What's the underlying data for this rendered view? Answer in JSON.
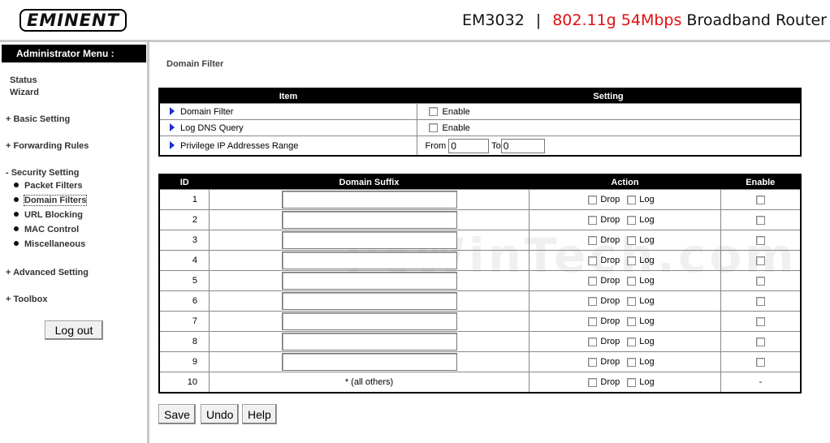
{
  "header": {
    "logo": "EMINENT",
    "model": "EM3032",
    "separator": "|",
    "spec": "802.11g 54Mbps",
    "product": "Broadband Router"
  },
  "sidebar": {
    "admin_menu": "Administrator Menu :",
    "items": [
      {
        "label": "Status"
      },
      {
        "label": "Wizard"
      },
      {
        "label": "+ Basic Setting"
      },
      {
        "label": "+ Forwarding Rules"
      },
      {
        "label": "- Security Setting"
      },
      {
        "label": "+ Advanced Setting"
      },
      {
        "label": "+ Toolbox"
      }
    ],
    "security_sub": [
      {
        "label": "Packet Filters"
      },
      {
        "label": "Domain Filters",
        "active": true
      },
      {
        "label": "URL Blocking"
      },
      {
        "label": "MAC Control"
      },
      {
        "label": "Miscellaneous"
      }
    ],
    "logout": "Log out"
  },
  "main": {
    "title": "Domain Filter",
    "settings": {
      "headers": {
        "item": "Item",
        "setting": "Setting"
      },
      "rows": [
        {
          "item": "Domain Filter",
          "checkbox_label": "Enable"
        },
        {
          "item": "Log DNS Query",
          "checkbox_label": "Enable"
        },
        {
          "item": "Privilege IP Addresses Range",
          "from_label": "From",
          "from_value": "0",
          "to_label": "To",
          "to_value": "0"
        }
      ]
    },
    "domains": {
      "headers": {
        "id": "ID",
        "suffix": "Domain Suffix",
        "action": "Action",
        "enable": "Enable"
      },
      "drop_label": "Drop",
      "log_label": "Log",
      "rows": [
        {
          "id": "1"
        },
        {
          "id": "2"
        },
        {
          "id": "3"
        },
        {
          "id": "4"
        },
        {
          "id": "5"
        },
        {
          "id": "6"
        },
        {
          "id": "7"
        },
        {
          "id": "8"
        },
        {
          "id": "9"
        }
      ],
      "last_row": {
        "id": "10",
        "suffix": "* (all others)",
        "enable": "-"
      }
    },
    "buttons": {
      "save": "Save",
      "undo": "Undo",
      "help": "Help"
    }
  },
  "watermark": "PcWinTech.com",
  "colors": {
    "spec_red": "#e01010",
    "arrow_blue": "#1a2fd0",
    "header_black": "#000000"
  }
}
